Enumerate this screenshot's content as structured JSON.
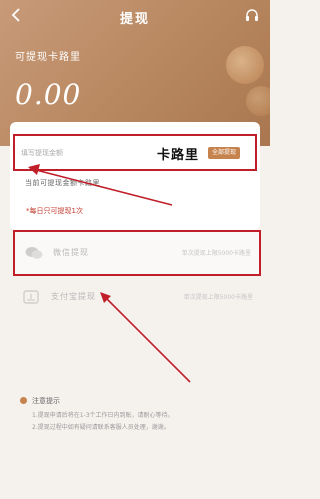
{
  "nav": {
    "title": "提现"
  },
  "balance": {
    "label": "可提现卡路里",
    "value": "0.00"
  },
  "withdraw": {
    "placeholder": "填写提现金额",
    "unit": "卡路里",
    "all_button": "全部提现",
    "hint": "当前可提现金额卡路里",
    "daily_limit": "*每日只可提现1次"
  },
  "methods": [
    {
      "name": "微信提现",
      "note": "单次提现上限5000卡路里",
      "icon": "wechat-icon"
    },
    {
      "name": "支付宝提现",
      "note": "单次提现上限5000卡路里",
      "icon": "card-icon"
    }
  ],
  "notes": {
    "title": "注意提示",
    "lines": [
      "1.提现申请后将在1-3个工作日内到账，请耐心等待。",
      "2.提现过程中如有疑问请联系客服人员处理，谢谢。"
    ]
  },
  "colors": {
    "header": "#b7875f",
    "accent": "#c6834e",
    "highlight": "#c01f2a"
  }
}
